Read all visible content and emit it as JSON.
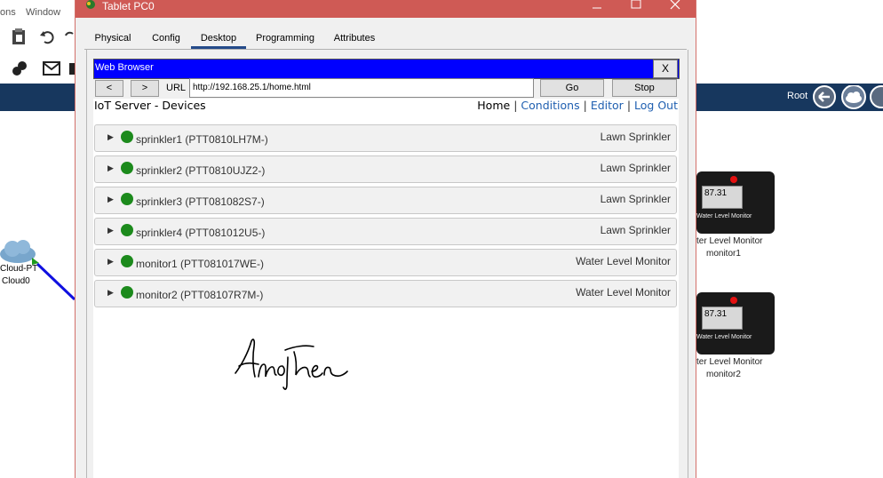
{
  "app_menu": [
    "ons",
    "Window"
  ],
  "window": {
    "title": "Tablet PC0",
    "controls": [
      "minimize",
      "maximize",
      "close"
    ]
  },
  "tabs": [
    {
      "label": "Physical",
      "active": false
    },
    {
      "label": "Config",
      "active": false
    },
    {
      "label": "Desktop",
      "active": true
    },
    {
      "label": "Programming",
      "active": false
    },
    {
      "label": "Attributes",
      "active": false
    }
  ],
  "browser": {
    "title": "Web Browser",
    "close_label": "X",
    "back_label": "<",
    "forward_label": ">",
    "url_label": "URL",
    "url_value": "http://192.168.25.1/home.html",
    "go_label": "Go",
    "stop_label": "Stop"
  },
  "page": {
    "title": "IoT Server - Devices",
    "nav": {
      "home": "Home",
      "conditions": "Conditions",
      "editor": "Editor",
      "logout": "Log Out",
      "sep": "|"
    },
    "devices": [
      {
        "name": "sprinkler1 (PTT0810LH7M-)",
        "type": "Lawn Sprinkler",
        "status_color": "#1c8a1c"
      },
      {
        "name": "sprinkler2 (PTT0810UJZ2-)",
        "type": "Lawn Sprinkler",
        "status_color": "#1c8a1c"
      },
      {
        "name": "sprinkler3 (PTT081082S7-)",
        "type": "Lawn Sprinkler",
        "status_color": "#1c8a1c"
      },
      {
        "name": "sprinkler4 (PTT081012U5-)",
        "type": "Lawn Sprinkler",
        "status_color": "#1c8a1c"
      },
      {
        "name": "monitor1 (PTT081017WE-)",
        "type": "Water Level Monitor",
        "status_color": "#1c8a1c"
      },
      {
        "name": "monitor2 (PTT08107R7M-)",
        "type": "Water Level Monitor",
        "status_color": "#1c8a1c"
      }
    ],
    "signature": "Another"
  },
  "workspace": {
    "root_label": "Root",
    "cloud": {
      "label1": "Cloud-PT",
      "label2": "Cloud0"
    },
    "monitors": [
      {
        "reading": "87.31",
        "screen_label": "Water Level Monitor",
        "caption1": "ter Level Monitor",
        "caption2": "monitor1"
      },
      {
        "reading": "87.31",
        "screen_label": "Water Level Monitor",
        "caption1": "ter Level Monitor",
        "caption2": "monitor2"
      }
    ]
  },
  "colors": {
    "titlebar": "#cf5a55",
    "browser_title": "#0000ff",
    "link": "#1f5fb0",
    "status_online": "#1c8a1c",
    "band": "#17375e"
  }
}
